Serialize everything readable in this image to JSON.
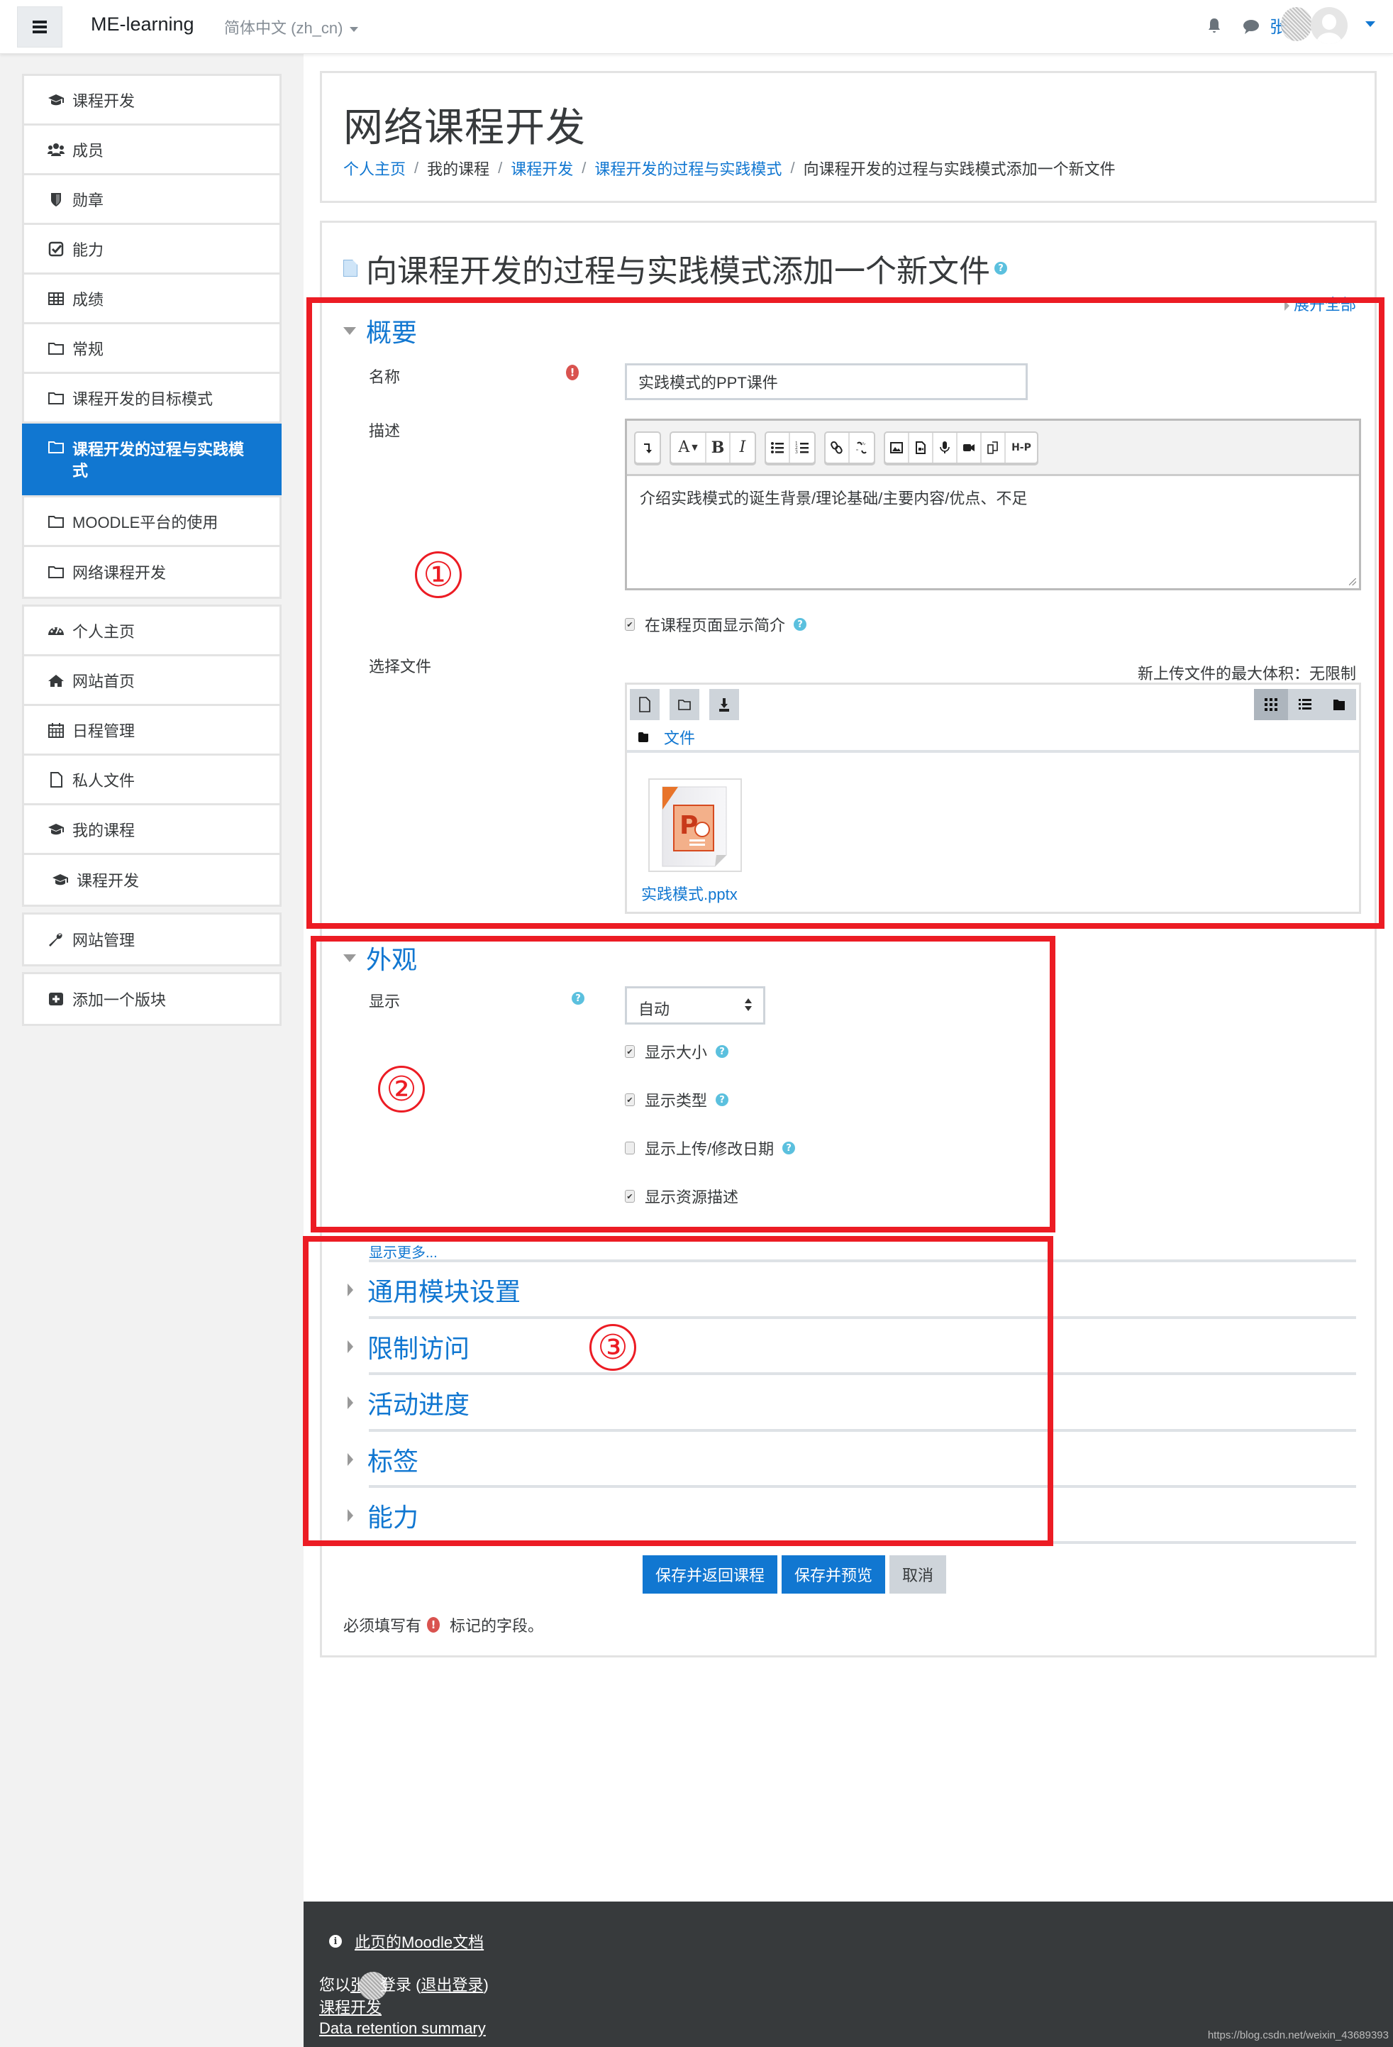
{
  "navbar": {
    "brand": "ME-learning",
    "language": "简体中文 (zh_cn)",
    "username": "张",
    "icons": [
      "menu-icon",
      "bell-icon",
      "chat-icon",
      "avatar",
      "caret-down-icon"
    ]
  },
  "sidebar": {
    "blocks": [
      {
        "items": [
          {
            "icon": "graduation-cap-icon",
            "label": "课程开发"
          },
          {
            "icon": "users-icon",
            "label": "成员"
          },
          {
            "icon": "shield-icon",
            "label": "勋章"
          },
          {
            "icon": "check-square-icon",
            "label": "能力"
          },
          {
            "icon": "table-icon",
            "label": "成绩"
          },
          {
            "icon": "folder-icon",
            "label": "常规"
          },
          {
            "icon": "folder-icon",
            "label": "课程开发的目标模式"
          },
          {
            "icon": "folder-icon",
            "label": "课程开发的过程与实践模式",
            "active": true
          },
          {
            "icon": "folder-icon",
            "label": "MOODLE平台的使用"
          },
          {
            "icon": "folder-icon",
            "label": "网络课程开发"
          }
        ]
      },
      {
        "items": [
          {
            "icon": "dashboard-icon",
            "label": "个人主页"
          },
          {
            "icon": "home-icon",
            "label": "网站首页"
          },
          {
            "icon": "calendar-icon",
            "label": "日程管理"
          },
          {
            "icon": "file-icon",
            "label": "私人文件"
          },
          {
            "icon": "graduation-cap-icon",
            "label": "我的课程"
          },
          {
            "icon": "graduation-cap-icon",
            "label": "课程开发"
          }
        ]
      },
      {
        "items": [
          {
            "icon": "wrench-icon",
            "label": "网站管理"
          }
        ]
      },
      {
        "items": [
          {
            "icon": "plus-square-icon",
            "label": "添加一个版块"
          }
        ]
      }
    ]
  },
  "header": {
    "title": "网络课程开发",
    "breadcrumb": [
      {
        "label": "个人主页",
        "link": true
      },
      {
        "label": "我的课程",
        "link": false
      },
      {
        "label": "课程开发",
        "link": true
      },
      {
        "label": "课程开发的过程与实践模式",
        "link": true
      },
      {
        "label": "向课程开发的过程与实践模式添加一个新文件",
        "link": false
      }
    ]
  },
  "form": {
    "title": "向课程开发的过程与实践模式添加一个新文件",
    "expand_all": "展开全部",
    "general": {
      "heading": "概要",
      "name_label": "名称",
      "name_value": "实践模式的PPT课件",
      "description_label": "描述",
      "description_value": "介绍实践模式的诞生背景/理论基础/主要内容/优点、不足",
      "show_on_course_page": {
        "label": "在课程页面显示简介",
        "checked": true
      },
      "select_files_label": "选择文件",
      "max_size": "新上传文件的最大体积：无限制",
      "files_path": "文件",
      "file": {
        "name": "实践模式.pptx",
        "type": "pptx"
      }
    },
    "editor_toolbar": [
      [
        "expand-toolbar"
      ],
      [
        "font-style",
        "bold",
        "italic"
      ],
      [
        "unordered-list",
        "ordered-list"
      ],
      [
        "link",
        "unlink"
      ],
      [
        "image",
        "media",
        "record-audio",
        "record-video",
        "manage-files",
        "h5p"
      ]
    ],
    "appearance": {
      "heading": "外观",
      "display_label": "显示",
      "display_value": "自动",
      "options": [
        {
          "label": "显示大小",
          "checked": true,
          "help": true
        },
        {
          "label": "显示类型",
          "checked": true,
          "help": true
        },
        {
          "label": "显示上传/修改日期",
          "checked": false,
          "help": true
        },
        {
          "label": "显示资源描述",
          "checked": true,
          "help": false
        }
      ],
      "show_more": "显示更多..."
    },
    "collapsed_sections": [
      "通用模块设置",
      "限制访问",
      "活动进度",
      "标签",
      "能力"
    ],
    "buttons": {
      "save_return": "保存并返回课程",
      "save_display": "保存并预览",
      "cancel": "取消"
    },
    "required_note_before": "必须填写有",
    "required_note_after": "标记的字段。"
  },
  "annotations": [
    "①",
    "②",
    "③"
  ],
  "annotation_color": "#ec1c24",
  "colors": {
    "brand": "#1177d1",
    "footer": "#373a3c"
  },
  "footer": {
    "doc_link": "此页的Moodle文档",
    "login_prefix": "您以",
    "login_name": "张",
    "login_suffix": "登录 (",
    "logout": "退出登录",
    "login_close": ")",
    "course_link": "课程开发",
    "data_retention": "Data retention summary",
    "watermark": "https://blog.csdn.net/weixin_43689393"
  }
}
